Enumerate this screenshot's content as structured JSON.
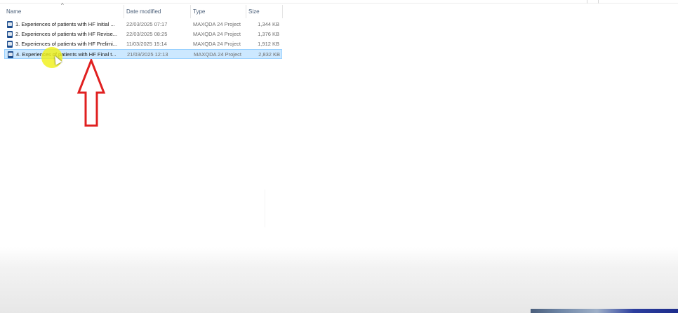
{
  "columns": {
    "name": "Name",
    "date": "Date modified",
    "type": "Type",
    "size": "Size"
  },
  "files": [
    {
      "name": "1. Experiences of patients with HF Initial ...",
      "date": "22/03/2025 07:17",
      "type": "MAXQDA 24 Project",
      "size": "1,344 KB",
      "selected": false
    },
    {
      "name": "2. Experiences of patients with HF Revise...",
      "date": "22/03/2025 08:25",
      "type": "MAXQDA 24 Project",
      "size": "1,376 KB",
      "selected": false
    },
    {
      "name": "3. Experiences of patients with HF Prelimi...",
      "date": "11/03/2025 15:14",
      "type": "MAXQDA 24 Project",
      "size": "1,912 KB",
      "selected": false
    },
    {
      "name": "4. Experiences of patients with HF Final t...",
      "date": "21/03/2025 12:13",
      "type": "MAXQDA 24 Project",
      "size": "2,832 KB",
      "selected": true
    }
  ],
  "icons": {
    "file": "maxqda-project-icon",
    "sort": "sort-ascending-icon",
    "annotation": "up-arrow-annotation",
    "cursor": "mouse-pointer-icon"
  },
  "colors": {
    "selection": "#cce8ff",
    "annotation_arrow": "#e02020",
    "cursor_highlight": "#f0f014"
  }
}
